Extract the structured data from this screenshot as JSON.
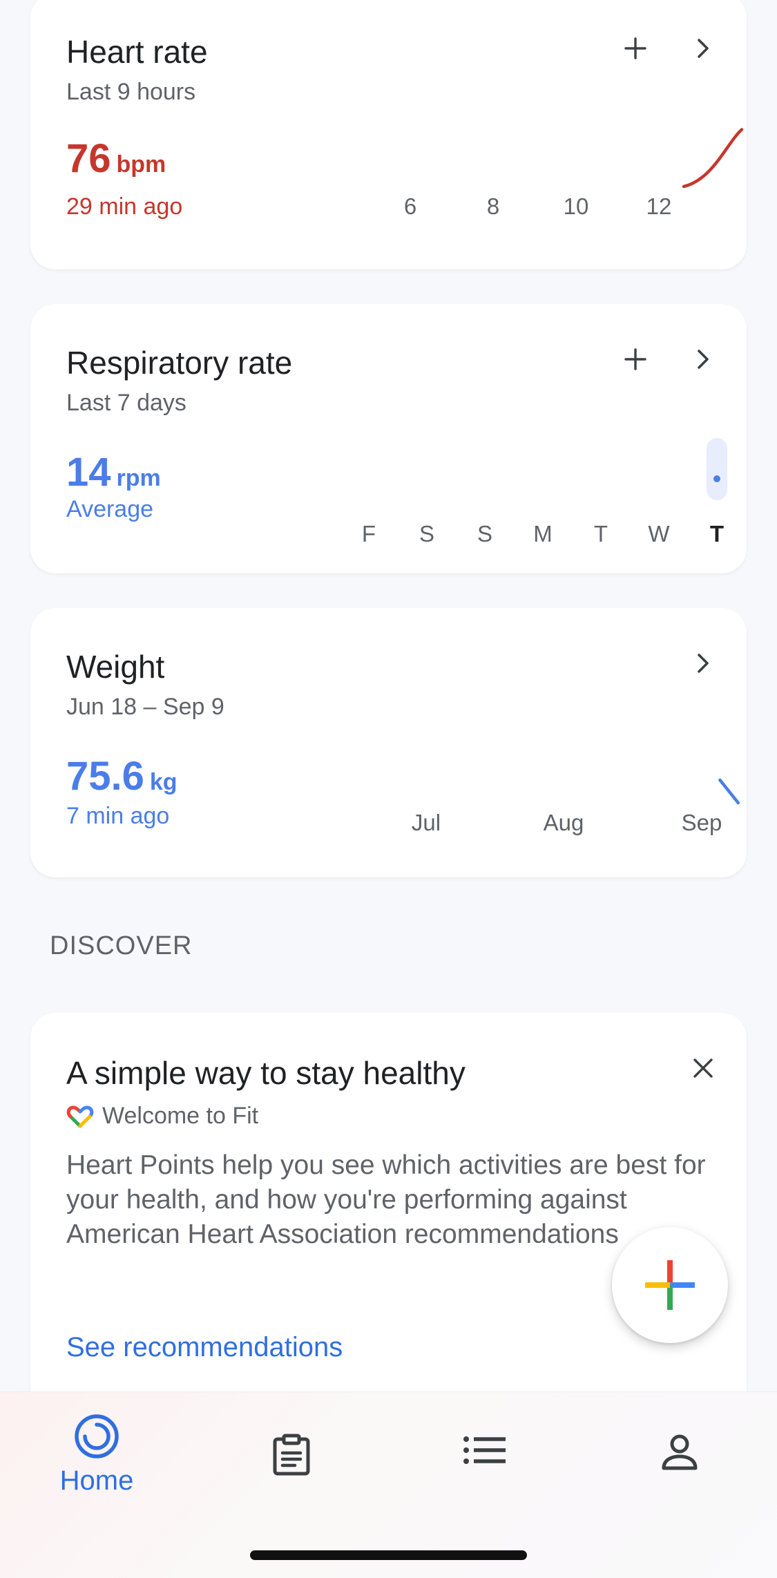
{
  "heart_rate": {
    "title": "Heart rate",
    "subtitle": "Last 9 hours",
    "value": "76",
    "unit": "bpm",
    "time_ago": "29 min ago",
    "add_icon": "plus-icon",
    "open_icon": "chevron-right-icon",
    "color": "#c5372c"
  },
  "respiratory_rate": {
    "title": "Respiratory rate",
    "subtitle": "Last 7 days",
    "value": "14",
    "unit": "rpm",
    "caption": "Average",
    "add_icon": "plus-icon",
    "open_icon": "chevron-right-icon",
    "color": "#4a7de8"
  },
  "weight": {
    "title": "Weight",
    "subtitle": "Jun 18 – Sep 9",
    "value": "75.6",
    "unit": "kg",
    "time_ago": "7 min ago",
    "open_icon": "chevron-right-icon",
    "color": "#4a7de8"
  },
  "chart_data": [
    {
      "type": "line",
      "x_ticks": [
        "6",
        "8",
        "10",
        "12"
      ],
      "x": [
        12.6,
        14.0
      ],
      "values": [
        62,
        84
      ],
      "xlim": [
        5,
        14
      ],
      "color": "#c5372c"
    },
    {
      "type": "scatter",
      "categories": [
        "F",
        "S",
        "S",
        "M",
        "T",
        "W",
        "T"
      ],
      "values": [
        null,
        null,
        null,
        null,
        null,
        null,
        14
      ],
      "highlighted_index": 6,
      "color": "#4a7de8"
    },
    {
      "type": "line",
      "x_ticks": [
        "Jul",
        "Aug",
        "Sep"
      ],
      "x": [
        "Sep 5",
        "Sep 9"
      ],
      "values": [
        75.9,
        75.6
      ],
      "color": "#4a7de8"
    }
  ],
  "discover": {
    "heading": "DISCOVER",
    "card": {
      "title": "A simple way to stay healthy",
      "brand_icon": "google-fit-heart-logo-icon",
      "brand": "Welcome to Fit",
      "body": "Heart Points help you see which activities are best for your health, and how you're performing against American Heart Association recommendations",
      "link": "See recommendations",
      "close_icon": "close-icon"
    }
  },
  "fab": {
    "icon": "multicolor-plus-icon"
  },
  "nav": {
    "items": [
      {
        "label": "Home",
        "icon": "home-ring-icon",
        "active": true
      },
      {
        "icon": "journal-clipboard-icon"
      },
      {
        "icon": "browse-list-icon"
      },
      {
        "icon": "profile-person-icon"
      }
    ],
    "active_color": "#2f6fe0"
  }
}
